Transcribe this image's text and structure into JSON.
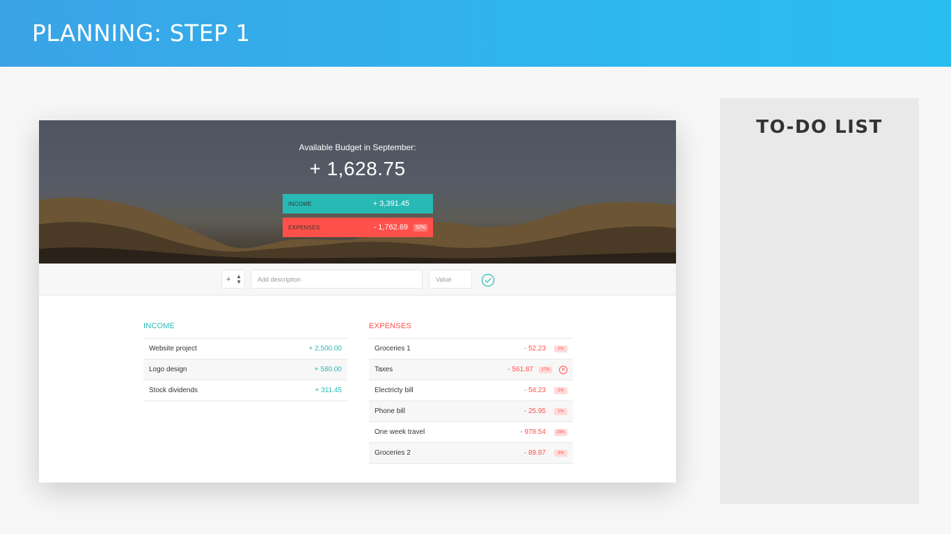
{
  "slide": {
    "title": "PLANNING: STEP 1"
  },
  "budget": {
    "label": "Available Budget in September:",
    "value": "+ 1,628.75",
    "income": {
      "label": "INCOME",
      "value": "+ 3,391.45"
    },
    "expenses": {
      "label": "EXPENSES",
      "value": "- 1,762.69",
      "percentage": "52%"
    }
  },
  "add_form": {
    "type_value": "+",
    "description_placeholder": "Add description",
    "value_placeholder": "Value"
  },
  "income_list": {
    "title": "INCOME",
    "items": [
      {
        "description": "Website project",
        "value": "+ 2,500.00"
      },
      {
        "description": "Logo design",
        "value": "+ 580.00"
      },
      {
        "description": "Stock dividends",
        "value": "+ 311.45"
      }
    ]
  },
  "expenses_list": {
    "title": "EXPENSES",
    "items": [
      {
        "description": "Groceries 1",
        "value": "- 52.23",
        "percentage": "2%"
      },
      {
        "description": "Taxes",
        "value": "- 561.87",
        "percentage": "17%"
      },
      {
        "description": "Electricty bill",
        "value": "- 54.23",
        "percentage": "2%"
      },
      {
        "description": "Phone bill",
        "value": "- 25.95",
        "percentage": "1%"
      },
      {
        "description": "One week travel",
        "value": "- 978.54",
        "percentage": "29%"
      },
      {
        "description": "Groceries 2",
        "value": "- 89.87",
        "percentage": "3%"
      }
    ]
  },
  "todo": {
    "title": "TO-DO LIST"
  },
  "colors": {
    "header": "#2fb6ee",
    "income": "#28b9b5",
    "expense": "#ff5049",
    "todo_panel": "#e9e9e9"
  },
  "icons": {
    "add": "check-circle-icon",
    "delete": "close-circle-icon",
    "select_arrows": "up-down-arrows-icon"
  }
}
